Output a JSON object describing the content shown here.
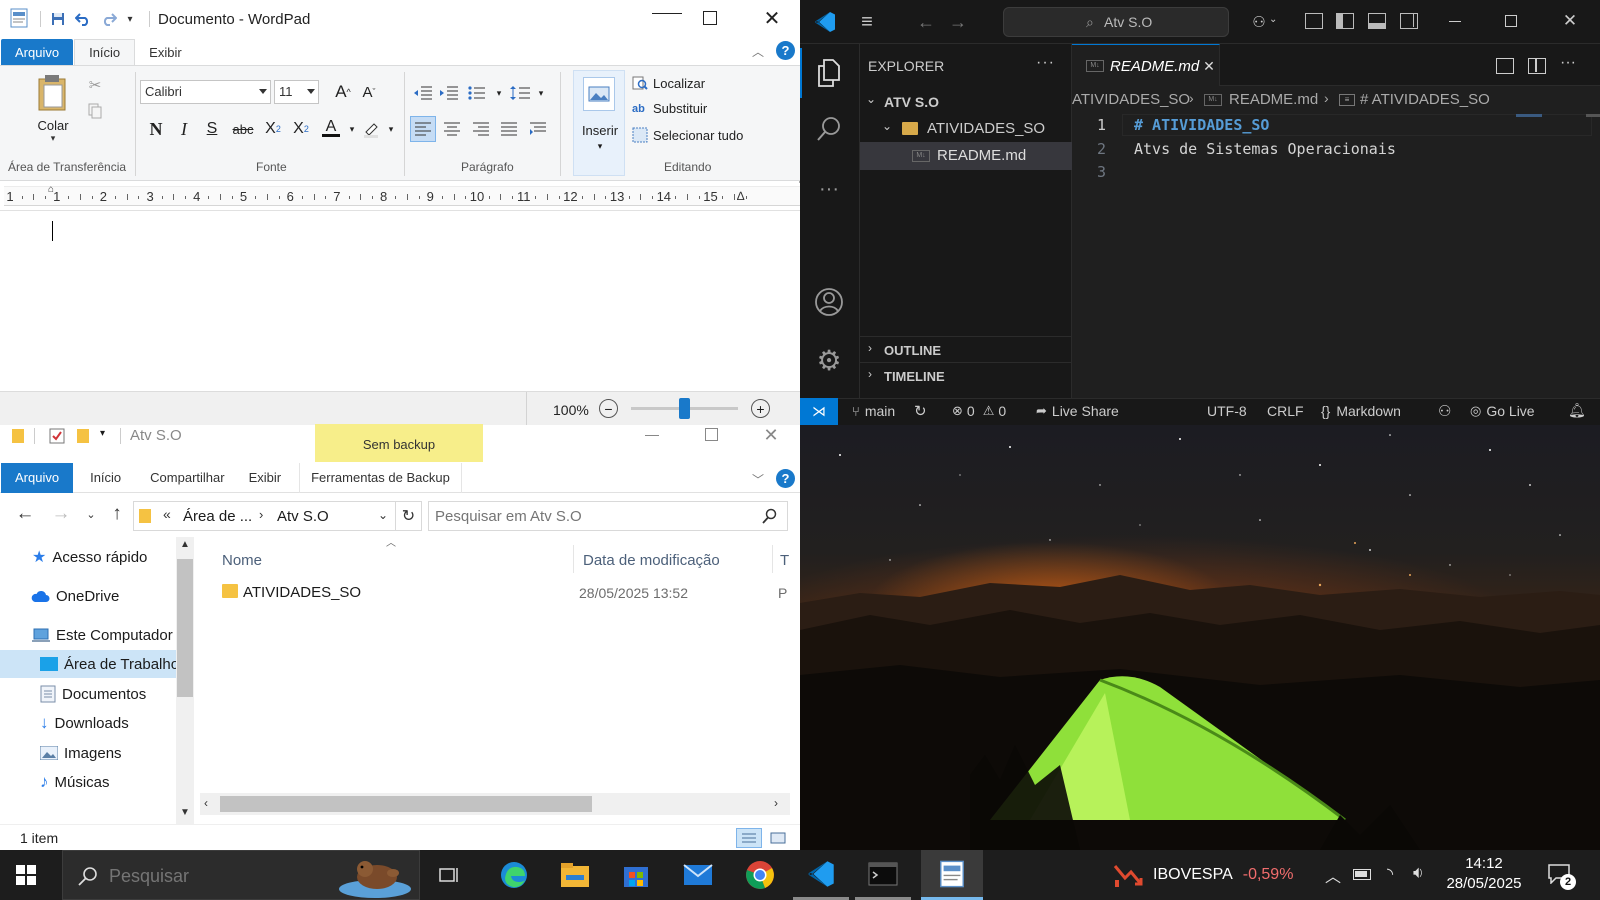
{
  "wordpad": {
    "title": "Documento - WordPad",
    "tabs": [
      "Arquivo",
      "Início",
      "Exibir"
    ],
    "clipboard": {
      "paste_label": "Colar",
      "group_label": "Área de Transferência"
    },
    "font": {
      "family": "Calibri",
      "size": "11",
      "group_label": "Fonte",
      "bold_glyph": "N",
      "italic_glyph": "I",
      "underline_glyph": "S",
      "strike_glyph": "abc"
    },
    "paragraph": {
      "group_label": "Parágrafo"
    },
    "insert": {
      "label": "Inserir"
    },
    "editing": {
      "find": "Localizar",
      "replace": "Substituir",
      "select_all": "Selecionar tudo",
      "group_label": "Editando"
    },
    "ruler": [
      "1",
      "1",
      "2",
      "3",
      "4",
      "5",
      "6",
      "7",
      "8",
      "9",
      "10",
      "11",
      "12",
      "13",
      "14",
      "15"
    ],
    "zoom": "100%",
    "zoom_level": 0.5
  },
  "explorer": {
    "title": "Atv S.O",
    "context_tab": "Sem backup",
    "tabs": [
      "Arquivo",
      "Início",
      "Compartilhar",
      "Exibir",
      "Ferramentas de Backup"
    ],
    "breadcrumb": [
      "«",
      "Área de ...",
      "Atv S.O"
    ],
    "search_placeholder": "Pesquisar em Atv S.O",
    "sidebar": [
      {
        "label": "Acesso rápido",
        "icon": "star-icon"
      },
      {
        "label": "OneDrive",
        "icon": "cloud-icon"
      },
      {
        "label": "Este Computador",
        "icon": "computer-icon"
      },
      {
        "label": "Área de Trabalho",
        "icon": "desktop-icon"
      },
      {
        "label": "Documentos",
        "icon": "document-icon"
      },
      {
        "label": "Downloads",
        "icon": "download-icon"
      },
      {
        "label": "Imagens",
        "icon": "image-icon"
      },
      {
        "label": "Músicas",
        "icon": "music-icon"
      }
    ],
    "columns": [
      "Nome",
      "Data de modificação",
      "T"
    ],
    "rows": [
      {
        "name": "ATIVIDADES_SO",
        "modified": "28/05/2025 13:52",
        "type": "P"
      }
    ],
    "status": "1 item"
  },
  "vscode": {
    "search_text": "Atv S.O",
    "explorer_title": "EXPLORER",
    "explorer_more": "···",
    "workspace": "ATV S.O",
    "folder": "ATIVIDADES_SO",
    "file": "README.md",
    "outline": "OUTLINE",
    "timeline": "TIMELINE",
    "tab_label": "README.md",
    "breadcrumb": [
      "ATIVIDADES_SO",
      "README.md",
      "# ATIVIDADES_SO"
    ],
    "lines": [
      {
        "num": "1",
        "text": "# ATIVIDADES_SO"
      },
      {
        "num": "2",
        "text": "Atvs de Sistemas Operacionais"
      },
      {
        "num": "3",
        "text": ""
      }
    ],
    "status": {
      "branch": "main",
      "errors": "0",
      "warnings": "0",
      "live_share": "Live Share",
      "encoding": "UTF-8",
      "eol": "CRLF",
      "language": "Markdown",
      "go_live": "Go Live"
    }
  },
  "taskbar": {
    "search_placeholder": "Pesquisar",
    "stock_name": "IBOVESPA",
    "stock_change": "-0,59%",
    "time": "14:12",
    "date": "28/05/2025",
    "notifications": "2"
  },
  "colors": {
    "wordpad_accent": "#1979ca",
    "vscode_accent": "#0078d4",
    "stock_negative": "#f16d6d",
    "tent_green": "#8fe03a"
  }
}
